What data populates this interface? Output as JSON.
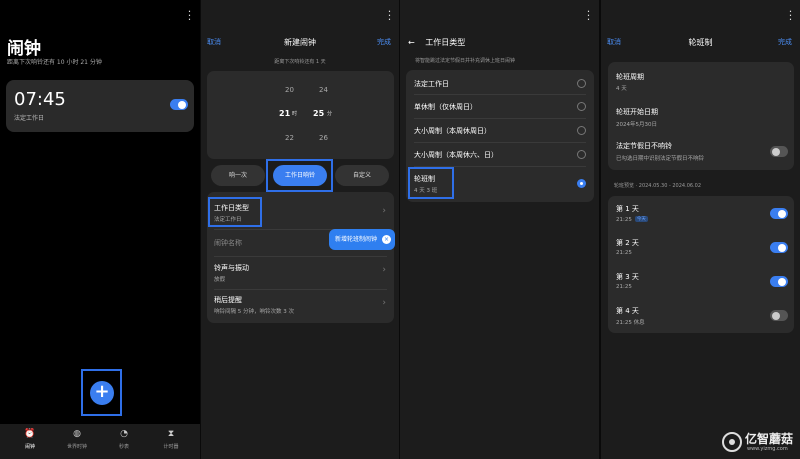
{
  "panel1": {
    "title": "闹钟",
    "subtitle": "距离下次响铃还有 10 小时 21 分钟",
    "alarm": {
      "time": "07:45",
      "label": "法定工作日",
      "enabled": true
    },
    "fab_label": "+",
    "nav": [
      {
        "label": "闹钟",
        "icon": "alarm-clock-icon"
      },
      {
        "label": "世界时钟",
        "icon": "globe-icon"
      },
      {
        "label": "秒表",
        "icon": "stopwatch-icon"
      },
      {
        "label": "计时器",
        "icon": "hourglass-icon"
      }
    ]
  },
  "panel2": {
    "cancel": "取消",
    "title": "新建闹钟",
    "done": "完成",
    "subtitle": "距离下次响铃还有 1 天",
    "picker": {
      "hour_above": "20",
      "minute_above": "24",
      "hour_selected": "21",
      "hour_unit": "时",
      "minute_selected": "25",
      "minute_unit": "分",
      "hour_below": "22",
      "minute_below": "26"
    },
    "segments": [
      "响一次",
      "工作日响铃",
      "自定义"
    ],
    "rows": [
      {
        "title": "工作日类型",
        "sub": "法定工作日"
      },
      {
        "title": "闹钟名称",
        "sub": ""
      },
      {
        "title": "铃声与振动",
        "sub": "放假"
      },
      {
        "title": "稍后提醒",
        "sub": "响铃间隔 5 分钟，响铃次数 3 次"
      }
    ],
    "tooltip": "新增轮班制闹钟",
    "tooltip_close": "×"
  },
  "panel3": {
    "back": "←",
    "title": "工作日类型",
    "subtitle": "将智能跳过法定节假日并补充调休上班日闹钟",
    "options": [
      {
        "label": "法定工作日",
        "sub": "",
        "selected": false
      },
      {
        "label": "单休制（仅休周日）",
        "sub": "",
        "selected": false
      },
      {
        "label": "大小周制（本周休周日）",
        "sub": "",
        "selected": false
      },
      {
        "label": "大小周制（本周休六、日）",
        "sub": "",
        "selected": false
      },
      {
        "label": "轮班制",
        "sub": "4 天 3 班",
        "selected": true
      }
    ]
  },
  "panel4": {
    "cancel": "取消",
    "title": "轮班制",
    "done": "完成",
    "cycle_label": "轮班周期",
    "cycle_value": "4 天",
    "start_label": "轮班开始日期",
    "start_value": "2024年5月30日",
    "holiday_label": "法定节假日不响铃",
    "holiday_sub": "已勾选日期中识别法定节假日不响铃",
    "holiday_enabled": false,
    "range": "轮班预览 · 2024.05.30 - 2024.06.02",
    "days": [
      {
        "name": "第 1 天",
        "time": "21:25",
        "badge": "今天",
        "enabled": true
      },
      {
        "name": "第 2 天",
        "time": "21:25",
        "badge": "",
        "enabled": true
      },
      {
        "name": "第 3 天",
        "time": "21:25",
        "badge": "",
        "enabled": true
      },
      {
        "name": "第 4 天",
        "time": "21:25 休息",
        "badge": "",
        "enabled": false
      }
    ]
  },
  "watermark": {
    "name": "亿智蘑菇",
    "url": "www.yizmg.com"
  },
  "colors": {
    "accent": "#3a7ef0",
    "highlight_box": "#2f6fe8",
    "card": "#2b2b2b"
  }
}
